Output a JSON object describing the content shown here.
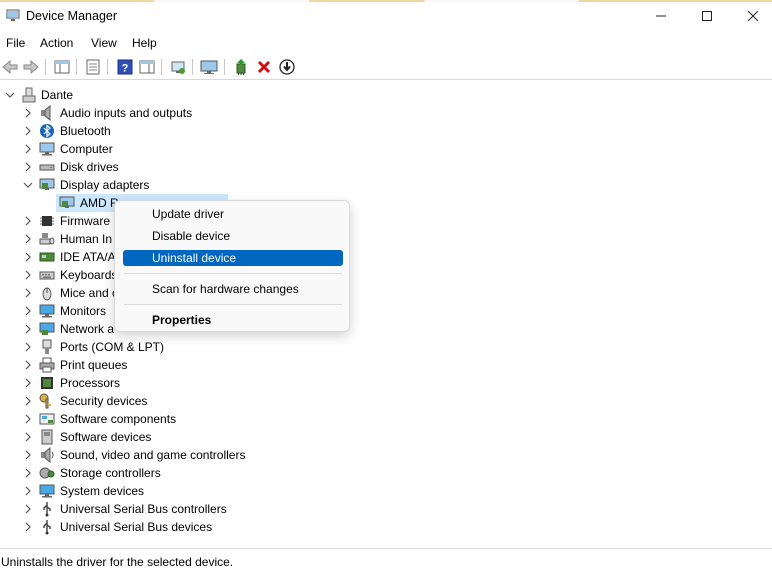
{
  "window": {
    "title": "Device Manager"
  },
  "menu": [
    "File",
    "Action",
    "View",
    "Help"
  ],
  "tree": {
    "root": "Dante",
    "categories": [
      {
        "label": "Audio inputs and outputs",
        "icon": "speaker-icon"
      },
      {
        "label": "Bluetooth",
        "icon": "bluetooth-icon"
      },
      {
        "label": "Computer",
        "icon": "computer-icon"
      },
      {
        "label": "Disk drives",
        "icon": "disk-drive-icon"
      },
      {
        "label": "Display adapters",
        "icon": "display-adapter-icon",
        "expanded": true,
        "children": [
          {
            "label": "AMD Radeon(TM) Graphics",
            "visible_label": "AMD R",
            "selected": true
          }
        ]
      },
      {
        "label": "Firmware",
        "icon": "chip-icon"
      },
      {
        "label": "Human In",
        "icon": "keyboard-mouse-icon"
      },
      {
        "label": "IDE ATA/A",
        "icon": "ide-controller-icon"
      },
      {
        "label": "Keyboards",
        "icon": "keyboard-icon"
      },
      {
        "label": "Mice and o",
        "icon": "mouse-icon"
      },
      {
        "label": "Monitors",
        "icon": "monitor-icon"
      },
      {
        "label": "Network a",
        "icon": "network-adapter-icon"
      },
      {
        "label": "Ports (COM & LPT)",
        "icon": "port-icon"
      },
      {
        "label": "Print queues",
        "icon": "printer-icon"
      },
      {
        "label": "Processors",
        "icon": "processor-icon"
      },
      {
        "label": "Security devices",
        "icon": "security-key-icon"
      },
      {
        "label": "Software components",
        "icon": "software-component-icon"
      },
      {
        "label": "Software devices",
        "icon": "software-device-icon"
      },
      {
        "label": "Sound, video and game controllers",
        "icon": "sound-icon"
      },
      {
        "label": "Storage controllers",
        "icon": "storage-controller-icon"
      },
      {
        "label": "System devices",
        "icon": "system-device-icon"
      },
      {
        "label": "Universal Serial Bus controllers",
        "icon": "usb-icon"
      },
      {
        "label": "Universal Serial Bus devices",
        "icon": "usb-icon"
      }
    ]
  },
  "context_menu": {
    "items": [
      "Update driver",
      "Disable device",
      "Uninstall device",
      "Scan for hardware changes",
      "Properties"
    ],
    "highlighted": "Uninstall device"
  },
  "status": "Uninstalls the driver for the selected device.",
  "colors": {
    "accent": "#0067c0",
    "selection": "#cce8ff"
  }
}
